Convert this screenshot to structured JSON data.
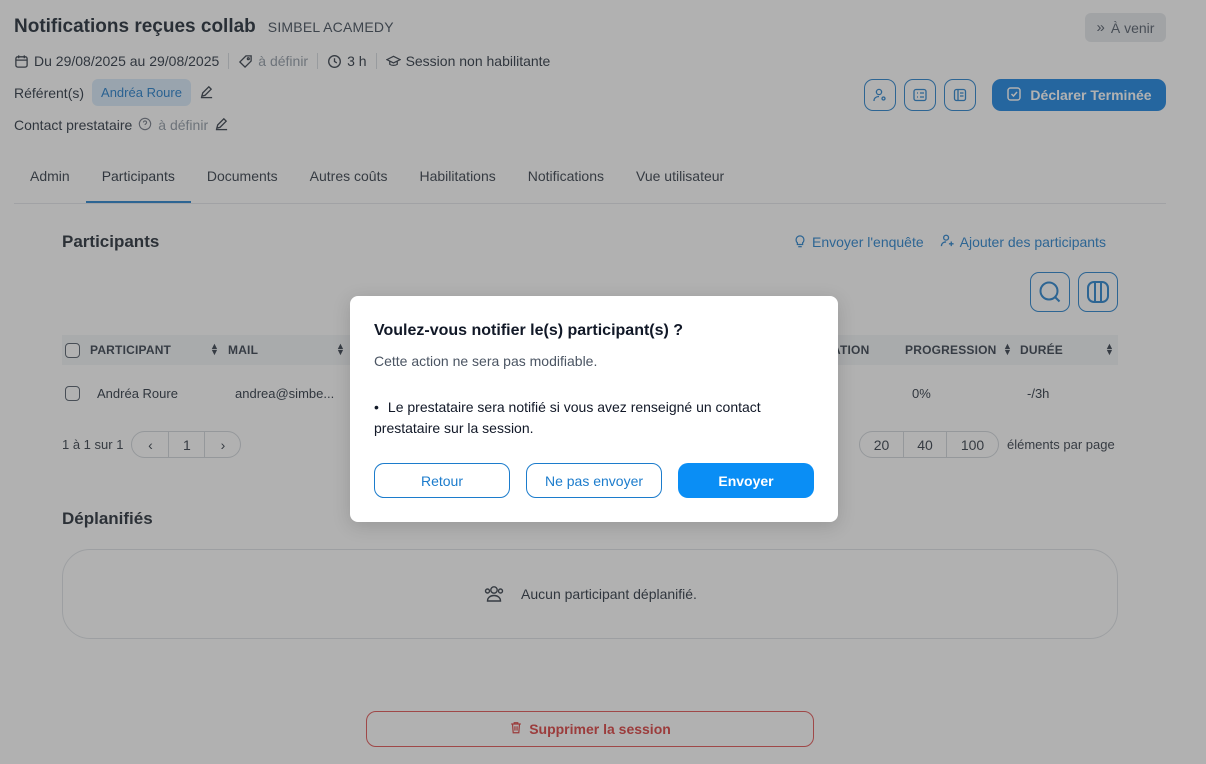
{
  "header": {
    "title": "Notifications reçues collab",
    "org": "SIMBEL ACAMEDY",
    "status_label": "À venir",
    "dates": "Du 29/08/2025 au 29/08/2025",
    "tag": "à définir",
    "duration": "3 h",
    "session_type": "Session non habilitante",
    "referent_label": "Référent(s)",
    "referent_name": "Andréa Roure",
    "contact_label": "Contact prestataire",
    "contact_value": "à définir",
    "declare_button": "Déclarer Terminée"
  },
  "tabs": [
    "Admin",
    "Participants",
    "Documents",
    "Autres coûts",
    "Habilitations",
    "Notifications",
    "Vue utilisateur"
  ],
  "participants": {
    "title": "Participants",
    "send_survey": "Envoyer l'enquête",
    "add_participants": "Ajouter des participants",
    "columns": {
      "participant": "PARTICIPANT",
      "mail": "MAIL",
      "validation_partial": "ATION",
      "progression": "PROGRESSION",
      "duration": "DURÉE"
    },
    "rows": [
      {
        "name": "Andréa Roure",
        "mail": "andrea@simbe...",
        "progression": "0%",
        "duration": "-/3h"
      }
    ],
    "range_text": "1 à 1 sur 1",
    "current_page": "1",
    "page_sizes": [
      "20",
      "40",
      "100"
    ],
    "per_page_label": "éléments par page"
  },
  "deplanified": {
    "title": "Déplanifiés",
    "empty_text": "Aucun participant déplanifié."
  },
  "delete_button": "Supprimer la session",
  "modal": {
    "title": "Voulez-vous notifier le(s) participant(s) ?",
    "subtitle": "Cette action ne sera pas modifiable.",
    "bullet_line1": "Le prestataire sera notifié si vous avez renseigné un contact",
    "bullet_line2": "prestataire sur la session.",
    "back_button": "Retour",
    "no_send_button": "Ne pas envoyer",
    "send_button": "Envoyer"
  },
  "colors": {
    "accent": "#1c7ccc",
    "primary": "#0f7ee0",
    "danger": "#d93636"
  }
}
